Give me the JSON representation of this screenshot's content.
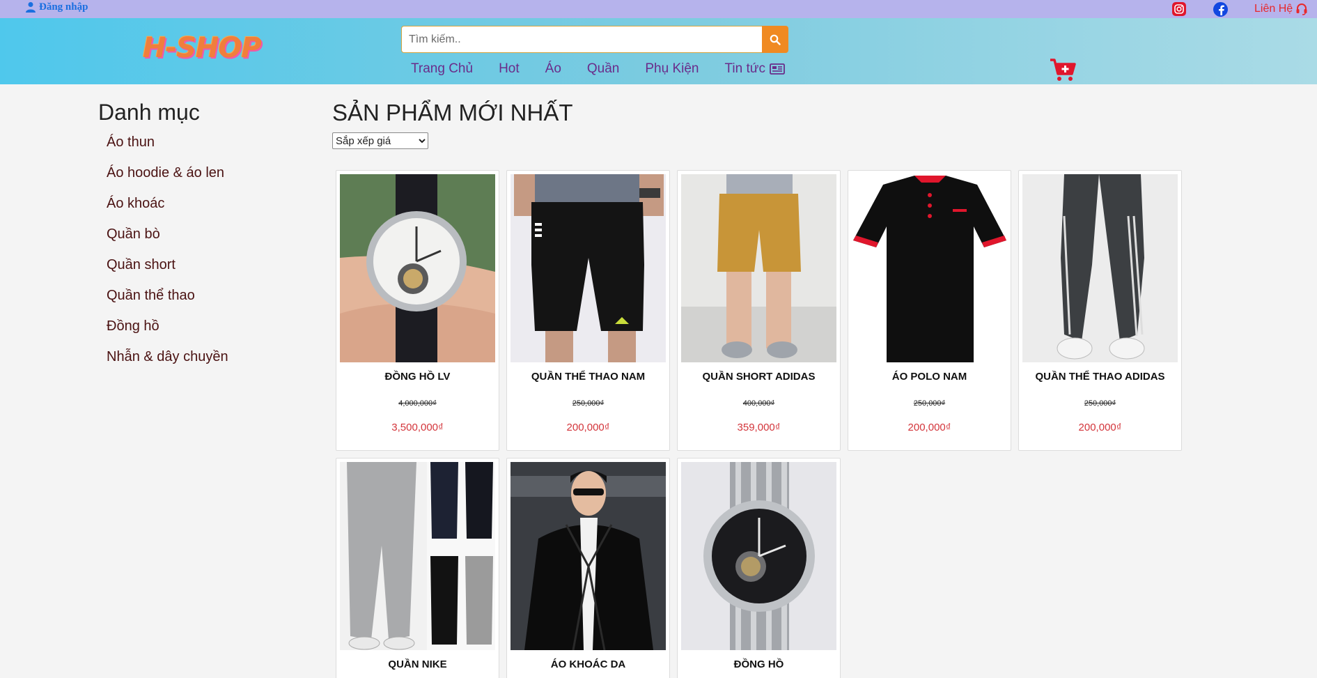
{
  "topbar": {
    "login_label": "Đăng nhập",
    "contact_label": "Liên Hệ"
  },
  "header": {
    "logo_text": "H-SHOP",
    "search_placeholder": "Tìm kiếm..",
    "nav": [
      "Trang Chủ",
      "Hot",
      "Áo",
      "Quần",
      "Phụ Kiện",
      "Tin tức"
    ]
  },
  "sidebar": {
    "title": "Danh mục",
    "items": [
      "Áo thun",
      "Áo hoodie & áo len",
      "Áo khoác",
      "Quần bò",
      "Quần short",
      "Quần thể thao",
      "Đồng hồ",
      "Nhẫn & dây chuyền"
    ]
  },
  "main": {
    "title": "SẢN PHẨM MỚI NHẤT",
    "sort_selected": "Sắp xếp giá",
    "products": [
      {
        "name": "ĐỒNG HỒ LV",
        "old_price": "4,000,000₫",
        "price": "3,500,000₫",
        "image": "watch-on-wrist"
      },
      {
        "name": "QUẦN THỂ THAO NAM",
        "old_price": "250,000₫",
        "price": "200,000₫",
        "image": "black-sport-shorts"
      },
      {
        "name": "QUẦN SHORT ADIDAS",
        "old_price": "400,000₫",
        "price": "359,000₫",
        "image": "khaki-shorts"
      },
      {
        "name": "ÁO POLO NAM",
        "old_price": "250,000₫",
        "price": "200,000₫",
        "image": "black-polo-shirt"
      },
      {
        "name": "QUẦN THỂ THAO ADIDAS",
        "old_price": "250,000₫",
        "price": "200,000₫",
        "image": "grey-track-pants"
      },
      {
        "name": "QUẦN NIKE",
        "image": "jogger-pants"
      },
      {
        "name": "ÁO KHOÁC DA",
        "image": "leather-jacket"
      },
      {
        "name": "ĐỒNG HỒ",
        "image": "steel-watch"
      }
    ]
  },
  "colors": {
    "topbar": "#b6b3ec",
    "nav_text": "#6a2c8a",
    "search_button": "#f08a22",
    "price": "#d3343a",
    "cart": "#e0162c"
  }
}
